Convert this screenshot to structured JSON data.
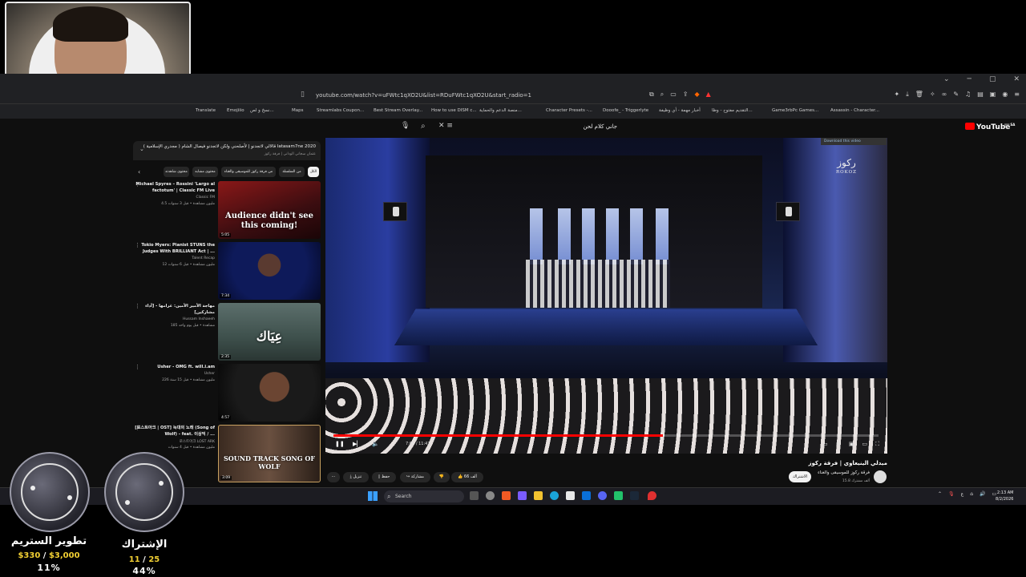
{
  "browser": {
    "url": "youtube.com/watch?v=uFWtc1qXO2U&list=RDuFWtc1qXO2U&start_radio=1",
    "bookmarks": [
      "Translate",
      "Emojiiio",
      "نسخ و لص...",
      "Maps",
      "Streamlabs Coupon...",
      "Best Stream Overlay...",
      "How to use DISM c...",
      "منصة الدعم والحماية...",
      "Character Presets -...",
      "Dooofe_ - Triggerlyte",
      "أخبار مهمة - أي وظيفة",
      "التقديم مفتوح - وظا...",
      "Game3rbPc Games...",
      "Assassin - Character..."
    ]
  },
  "youtube": {
    "search_query": "جاني كلام لحن",
    "logo": "YouTube",
    "logo_sup": "SA"
  },
  "playlist": {
    "title": "قالالي لاتجدنو | لأصلحني ولكن لاتجدنو فيصال الشام ( مجدري الإسلامية ) latasam7ne 2020",
    "subtitle": "عثمان سجاني الوداني | فرقة ركوز",
    "chips": [
      "الكل",
      "من السلسلة",
      "من فرقة ركوز للموسيقى والغناء",
      "محتوى مشابه",
      "محتوى شاهدته"
    ],
    "items": [
      {
        "title": "Michael Spyres – Rossini 'Largo al factotum' | Classic FM Live",
        "channel": "Classic FM",
        "meta": "4.5 مليون مشاهدة • قبل 3 سنوات",
        "duration": "5:05",
        "caption": "Audience didn't see this coming!"
      },
      {
        "title": "Tokio Myers: Pianist STUNS the Judges With BRILLIANT Act | ...",
        "channel": "Talent Recap",
        "meta": "12 مليون مشاهدة • قبل 6 سنوات",
        "duration": "7:34",
        "caption": ""
      },
      {
        "title": "مهاجة الأمير الأمين: غرامها - [أداء مشاركين]",
        "channel": "Hussam Inshaeeh",
        "meta": "185 مشاهدة • قبل يوم واحد",
        "duration": "2:35",
        "caption": "عِيَاك"
      },
      {
        "title": "Usher - OMG ft. will.i.am",
        "channel": "Usher",
        "meta": "226 مليون مشاهدة • قبل 15 سنة",
        "duration": "4:57",
        "caption": ""
      },
      {
        "title": "[로스트아크 | OST] 늑대의 노래 (Song of Wolf) - feat. 이상익 / ...",
        "channel": "로스트아크 LOST ARK",
        "meta": "مليون مشاهدة • قبل 4 سنوات",
        "duration": "3:09",
        "caption": "SOUND TRACK SONG OF WOLF"
      }
    ]
  },
  "player": {
    "time": "7:05 / 11:42",
    "progress": 0.605,
    "watermark_ar": "ركوز",
    "watermark_lat": "ROKOZ",
    "download_badge": "Download this video"
  },
  "video_info": {
    "title": "ميدلي الينيعاوي | فرقة ركوز",
    "channel": "فرقة ركوز للموسيقى والغناء",
    "subs": "15.8 ألف مشترك",
    "subscribe": "الاشتراك",
    "like_count": "66 ألف",
    "share": "مشاركة",
    "save": "حفظ",
    "download": "تنزيل"
  },
  "taskbar": {
    "search": "Search",
    "lang": "ع",
    "time": "2:13 AM",
    "date": "8/2/2026"
  },
  "goals": [
    {
      "title": "تطوير الستريم",
      "current": "$330",
      "target": "$3,000",
      "pct": "11%"
    },
    {
      "title": "الإشتراك",
      "current": "11",
      "target": "25",
      "pct": "44%"
    }
  ]
}
